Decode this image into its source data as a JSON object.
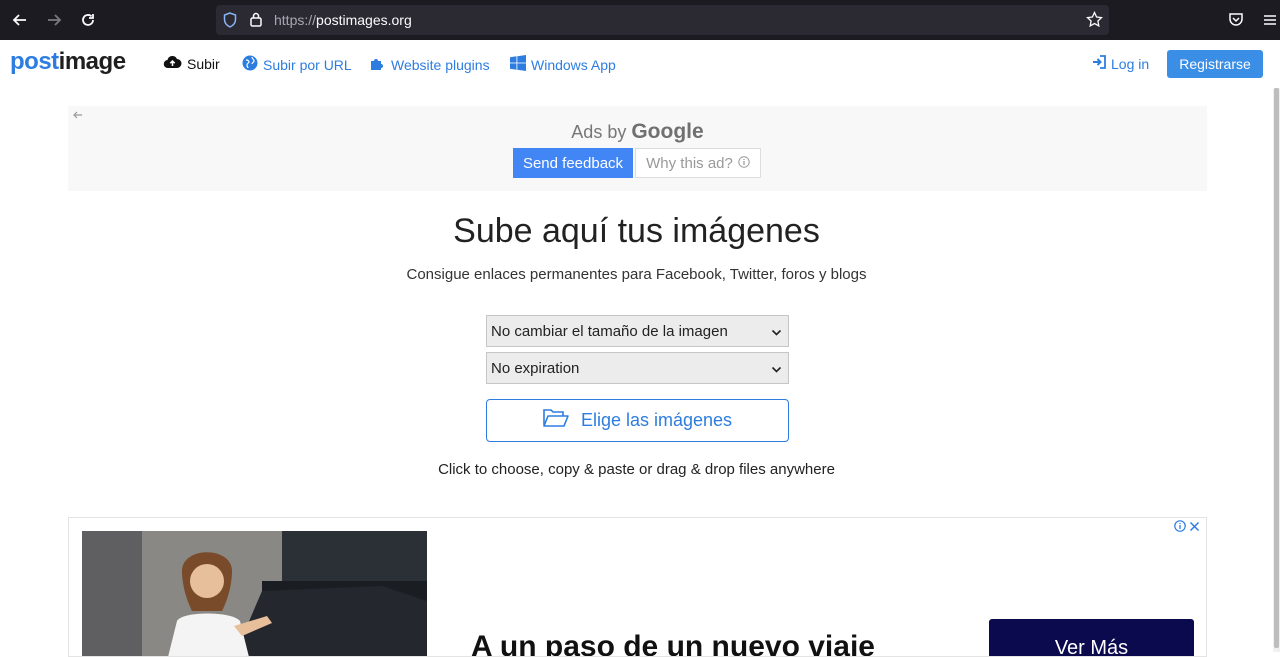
{
  "browser": {
    "url_protocol": "https://",
    "url_host": "postimages.org",
    "icons": [
      "back-arrow-icon",
      "forward-arrow-icon",
      "reload-icon",
      "shield-icon",
      "lock-icon",
      "star-icon",
      "pocket-icon",
      "menu-icon"
    ]
  },
  "nav": {
    "logo_post": "post",
    "logo_image": "image",
    "upload": "Subir",
    "upload_url": "Subir por URL",
    "plugins": "Website plugins",
    "windows_app": "Windows App",
    "login": "Log in",
    "register": "Registrarse"
  },
  "ad_top": {
    "ads_by": "Ads by",
    "google": "Google",
    "send_feedback": "Send feedback",
    "why_ad": "Why this ad?"
  },
  "main": {
    "title": "Sube aquí tus imágenes",
    "subtitle": "Consigue enlaces permanentes para Facebook, Twitter, foros y blogs",
    "resize_selected": "No cambiar el tamaño de la imagen",
    "expiration_selected": "No expiration",
    "choose_button": "Elige las imágenes",
    "hint": "Click to choose, copy & paste or drag & drop files anywhere"
  },
  "ad_bottom": {
    "headline": "A un paso de un nuevo viaje",
    "cta": "Ver Más"
  },
  "colors": {
    "accent": "#2d7de0",
    "register_bg": "#3a8ee6",
    "feedback_bg": "#4285f4",
    "cta_bg": "#0c0a4f"
  }
}
